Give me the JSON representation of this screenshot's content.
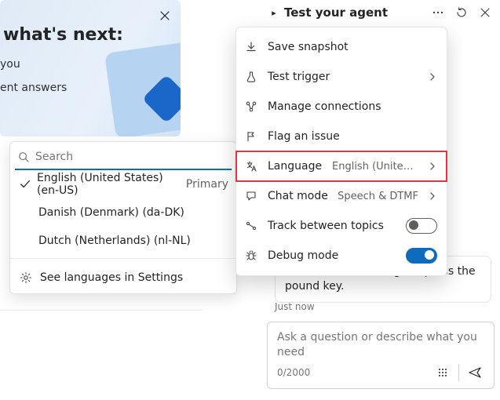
{
  "welcome": {
    "heading": "what's next:",
    "line1": "you",
    "line2": "ent answers"
  },
  "lang": {
    "search_placeholder": "Search",
    "items": [
      {
        "label": "English (United States) (en-US)",
        "tag": "Primary",
        "selected": true
      },
      {
        "label": "Danish (Denmark) (da-DK)",
        "selected": false
      },
      {
        "label": "Dutch (Netherlands) (nl-NL)",
        "selected": false
      }
    ],
    "footer": "See languages in Settings"
  },
  "test_panel": {
    "title": "Test your agent",
    "menu": {
      "save_snapshot": "Save snapshot",
      "test_trigger": "Test trigger",
      "manage_connections": "Manage connections",
      "flag_issue": "Flag an issue",
      "language": {
        "label": "Language",
        "value": "English (United …"
      },
      "chat_mode": {
        "label": "Chat mode",
        "value": "Speech & DTMF"
      },
      "track_between_topics": {
        "label": "Track between topics",
        "on": false
      },
      "debug_mode": {
        "label": "Debug mode",
        "on": true
      }
    },
    "bot_reply": "To hear this menu again, press the pound key.",
    "timestamp": "Just now",
    "composer": {
      "placeholder": "Ask a question or describe what you need",
      "counter": "0/2000"
    }
  }
}
